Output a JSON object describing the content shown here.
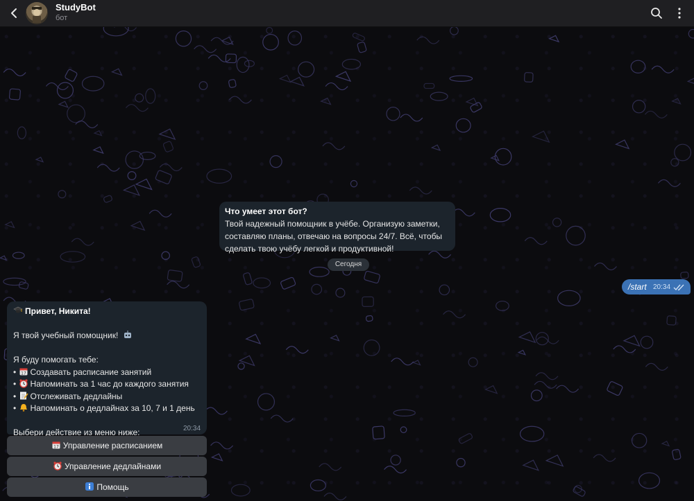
{
  "header": {
    "title": "StudyBot",
    "subtitle": "бот"
  },
  "intro": {
    "title": "Что умеет этот бот?",
    "lines": [
      "Твой надежный помощник в учёбе. Организую заметки,",
      "составляю планы, отвечаю на вопросы 24/7. Всё, чтобы",
      "сделать твою учёбу легкой и продуктивной!"
    ]
  },
  "date_chip": "Сегодня",
  "outgoing": {
    "text": "/start",
    "time": "20:34"
  },
  "incoming": {
    "greeting": "Привет, Никита!",
    "intro_line": "Я твой учебный помощник!",
    "help_line": "Я буду помогать тебе:",
    "bullets": [
      "Создавать расписание занятий",
      "Напоминать за 1 час до каждого занятия",
      "Отслеживать дедлайны",
      "Напоминать о дедлайнах за 10, 7 и 1 день"
    ],
    "prompt": "Выбери действие из меню ниже:",
    "time": "20:34"
  },
  "keyboard": {
    "schedule": "Управление расписанием",
    "deadlines": "Управление дедлайнами",
    "help": "Помощь"
  },
  "colors": {
    "header_bg": "#1f1f22",
    "bubble_in": "#1c242c",
    "bubble_out": "#3b72b5",
    "keyboard_button": "#3a3d42"
  },
  "icons": {
    "back": "back-arrow-icon",
    "search": "search-icon",
    "menu": "more-vertical-icon",
    "read": "double-check-icon"
  }
}
